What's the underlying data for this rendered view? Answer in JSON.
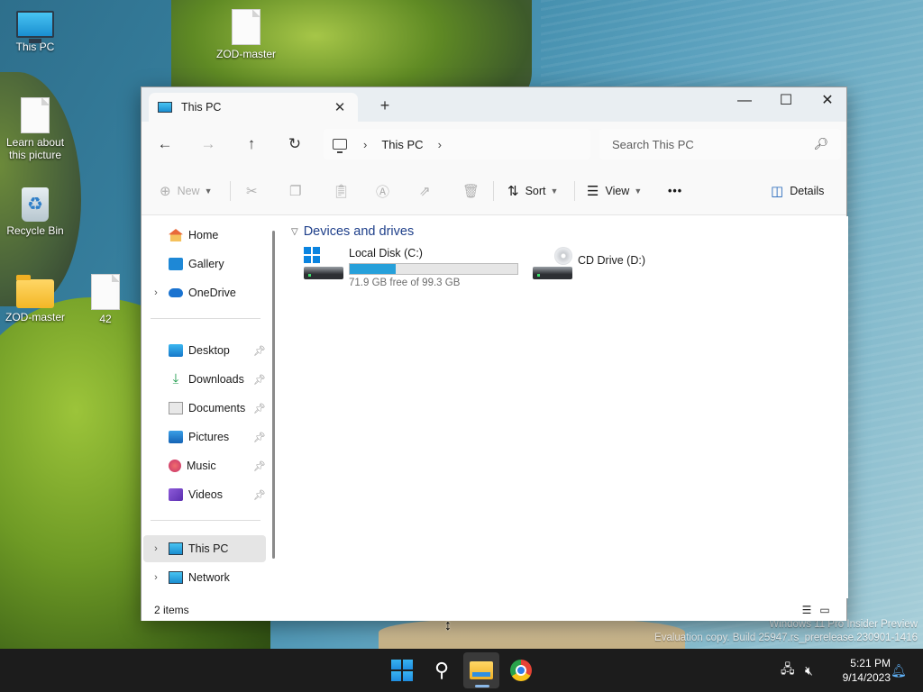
{
  "desktop": {
    "icons": [
      {
        "label": "This PC"
      },
      {
        "label": "ZOD-master"
      },
      {
        "label": "Learn about this picture"
      },
      {
        "label": "Recycle Bin"
      },
      {
        "label": "ZOD-master"
      },
      {
        "label": "42"
      }
    ],
    "watermark": {
      "line1": "Windows 11 Pro Insider Preview",
      "line2": "Evaluation copy. Build 25947.rs_prerelease.230901-1416"
    }
  },
  "window": {
    "tab_title": "This PC",
    "tab_close": "✕",
    "new_tab": "+",
    "controls": {
      "minimize": "—",
      "maximize": "☐",
      "close": "✕"
    },
    "nav": {
      "back": "←",
      "forward": "→",
      "up": "↑",
      "refresh": "↻"
    },
    "breadcrumb": [
      "This PC"
    ],
    "search_placeholder": "Search This PC",
    "toolbar": {
      "new_label": "New",
      "sort_label": "Sort",
      "view_label": "View",
      "more_label": "•••",
      "details_label": "Details"
    },
    "sidebar": {
      "items": [
        {
          "label": "Home",
          "icon": "home-icon"
        },
        {
          "label": "Gallery",
          "icon": "gallery-icon"
        },
        {
          "label": "OneDrive",
          "icon": "onedrive-icon",
          "expandable": true
        },
        {
          "label": "Desktop",
          "icon": "desktop-folder-icon",
          "pinned": true
        },
        {
          "label": "Downloads",
          "icon": "downloads-icon",
          "pinned": true
        },
        {
          "label": "Documents",
          "icon": "documents-icon",
          "pinned": true
        },
        {
          "label": "Pictures",
          "icon": "pictures-icon",
          "pinned": true
        },
        {
          "label": "Music",
          "icon": "music-icon",
          "pinned": true
        },
        {
          "label": "Videos",
          "icon": "videos-icon",
          "pinned": true
        },
        {
          "label": "This PC",
          "icon": "this-pc-icon",
          "expandable": true,
          "selected": true
        },
        {
          "label": "Network",
          "icon": "network-icon",
          "expandable": true
        }
      ]
    },
    "content": {
      "group_label": "Devices and drives",
      "drives": [
        {
          "name": "Local Disk (C:)",
          "free_text": "71.9 GB free of 99.3 GB",
          "used_fraction": 0.276,
          "icon": "local-disk-icon"
        },
        {
          "name": "CD Drive (D:)",
          "icon": "cd-drive-icon"
        }
      ]
    },
    "status": {
      "item_count": "2 items"
    }
  },
  "taskbar": {
    "clock_time": "5:21 PM",
    "clock_date": "9/14/2023"
  },
  "colors": {
    "accent": "#26a0da",
    "group_header": "#1e3f8a",
    "taskbar": "#1c1c1c"
  }
}
